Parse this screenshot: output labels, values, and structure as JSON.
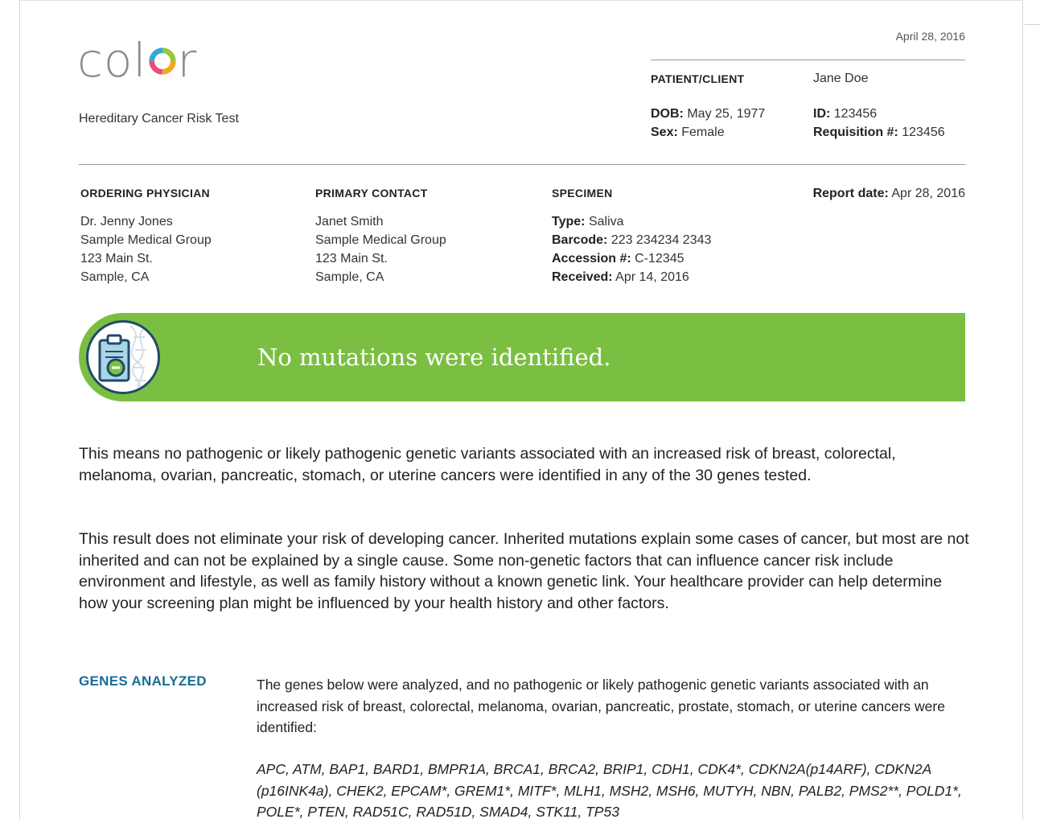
{
  "report": {
    "logo_text": "color",
    "test_name": "Hereditary Cancer Risk Test",
    "date": "April 28, 2016"
  },
  "patient": {
    "section_label": "PATIENT/CLIENT",
    "name": "Jane Doe",
    "dob_label": "DOB:",
    "dob": "May 25, 1977",
    "sex_label": "Sex:",
    "sex": "Female",
    "id_label": "ID:",
    "id": "123456",
    "req_label": "Requisition #:",
    "req": "123456"
  },
  "physician": {
    "label": "ORDERING PHYSICIAN",
    "lines": [
      "Dr. Jenny Jones",
      "Sample Medical Group",
      "123 Main St.",
      "Sample, CA"
    ]
  },
  "contact": {
    "label": "PRIMARY CONTACT",
    "lines": [
      "Janet Smith",
      "Sample Medical Group",
      "123 Main St.",
      "Sample, CA"
    ]
  },
  "specimen": {
    "label": "SPECIMEN",
    "type_label": "Type:",
    "type": "Saliva",
    "barcode_label": "Barcode:",
    "barcode": "223 234234 2343",
    "accession_label": "Accession #:",
    "accession": "C-12345",
    "received_label": "Received:",
    "received": "Apr 14, 2016"
  },
  "report_date": {
    "label": "Report date:",
    "value": "Apr 28, 2016"
  },
  "result": {
    "headline": "No mutations were identified.",
    "color": "#7bbf42",
    "icon": "clipboard-minus-icon"
  },
  "body": {
    "paragraph1": "This means no pathogenic or likely pathogenic genetic variants associated with an increased risk of breast, colorectal, melanoma, ovarian, pancreatic, stomach, or uterine cancers were identified in any of the 30 genes tested.",
    "paragraph2": "This result does not eliminate your risk of developing cancer. Inherited mutations explain some cases of cancer, but most are not inherited and can not be explained by a single cause. Some non-genetic factors that can influence cancer risk include environment and lifestyle, as well as family history without a known genetic link. Your healthcare provider can help determine how your screening plan might be influenced by your health history and other factors."
  },
  "genes": {
    "label": "GENES ANALYZED",
    "intro": "The genes below were analyzed, and no pathogenic or likely pathogenic genetic variants associated with an increased risk of breast, colorectal, melanoma, ovarian, pancreatic, prostate, stomach, or uterine cancers were identified:",
    "list": "APC, ATM, BAP1, BARD1, BMPR1A, BRCA1, BRCA2, BRIP1, CDH1, CDK4*, CDKN2A(p14ARF), CDKN2A (p16INK4a), CHEK2, EPCAM*, GREM1*, MITF*, MLH1, MSH2, MSH6, MUTYH, NBN, PALB2, PMS2**, POLD1*, POLE*, PTEN, RAD51C, RAD51D, SMAD4, STK11, TP53",
    "accent_color": "#1a6c95"
  }
}
